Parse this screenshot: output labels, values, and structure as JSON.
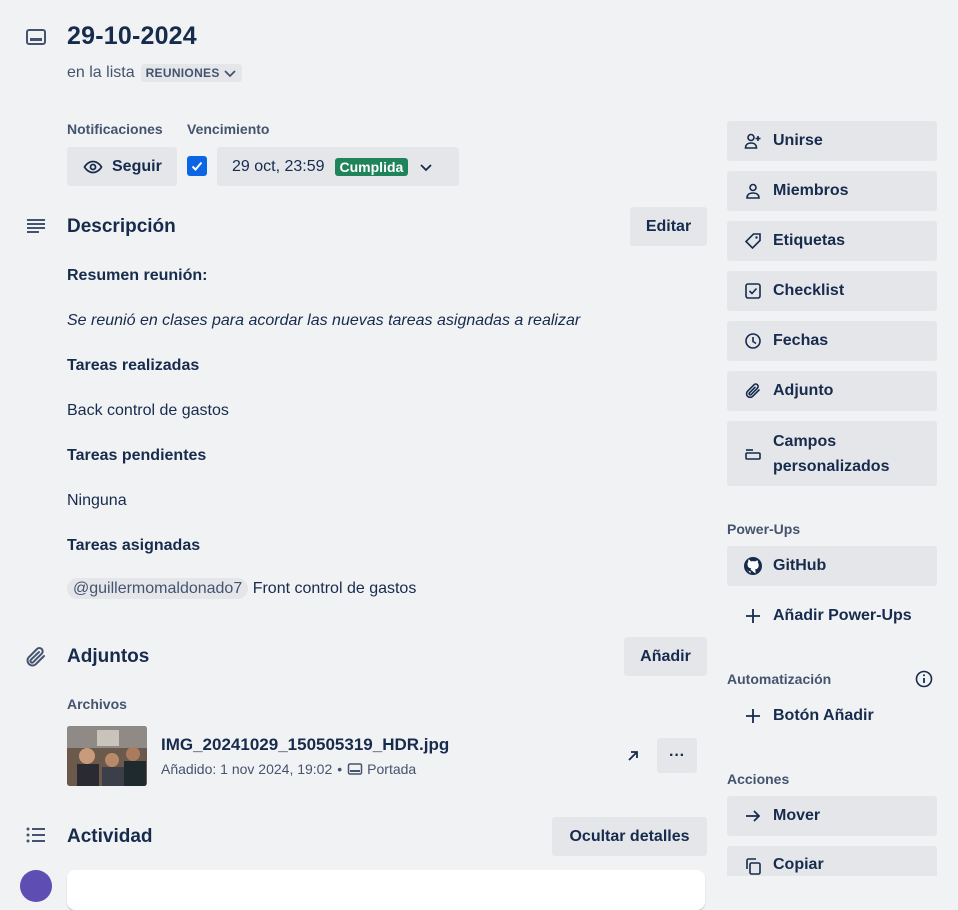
{
  "card": {
    "title": "29-10-2024",
    "list_prefix": "en la lista",
    "list_name": "REUNIONES"
  },
  "notifications": {
    "label": "Notificaciones",
    "follow_button": "Seguir"
  },
  "due": {
    "label": "Vencimiento",
    "checked": true,
    "date": "29 oct, 23:59",
    "status": "Cumplida",
    "status_color": "#1f845a"
  },
  "description": {
    "title": "Descripción",
    "edit_button": "Editar",
    "summary_heading": "Resumen reunión:",
    "summary_text": "Se reunió en clases para acordar las nuevas tareas asignadas a realizar",
    "done_heading": "Tareas realizadas",
    "done_text": "Back control de gastos",
    "pending_heading": "Tareas pendientes",
    "pending_text": "Ninguna",
    "assigned_heading": "Tareas asignadas",
    "assigned_mention": "@guillermomaldonado7",
    "assigned_text": "Front control de gastos"
  },
  "attachments": {
    "title": "Adjuntos",
    "add_button": "Añadir",
    "files_label": "Archivos",
    "file": {
      "name": "IMG_20241029_150505319_HDR.jpg",
      "added": "Añadido: 1 nov 2024, 19:02",
      "separator": "•",
      "cover_label": "Portada",
      "more": "···"
    }
  },
  "activity": {
    "title": "Actividad",
    "hide_details_button": "Ocultar detalles"
  },
  "sidebar": {
    "actions": [
      {
        "label": "Unirse",
        "icon": "add-user-icon"
      },
      {
        "label": "Miembros",
        "icon": "user-icon"
      },
      {
        "label": "Etiquetas",
        "icon": "tag-icon"
      },
      {
        "label": "Checklist",
        "icon": "checklist-icon"
      },
      {
        "label": "Fechas",
        "icon": "clock-icon"
      },
      {
        "label": "Adjunto",
        "icon": "paperclip-icon"
      },
      {
        "label_line1": "Campos",
        "label_line2": "personalizados",
        "icon": "custom-fields-icon"
      }
    ],
    "powerups_heading": "Power-Ups",
    "github": "GitHub",
    "add_powerups": "Añadir Power-Ups",
    "automation_heading": "Automatización",
    "add_button_label": "Botón Añadir",
    "actions_heading": "Acciones",
    "move": "Mover",
    "copy": "Copiar"
  },
  "colors": {
    "background": "#f1f2f4",
    "button": "#e4e6ea",
    "text": "#172b4d",
    "subtle": "#44546f",
    "checkbox": "#0c66e4"
  }
}
